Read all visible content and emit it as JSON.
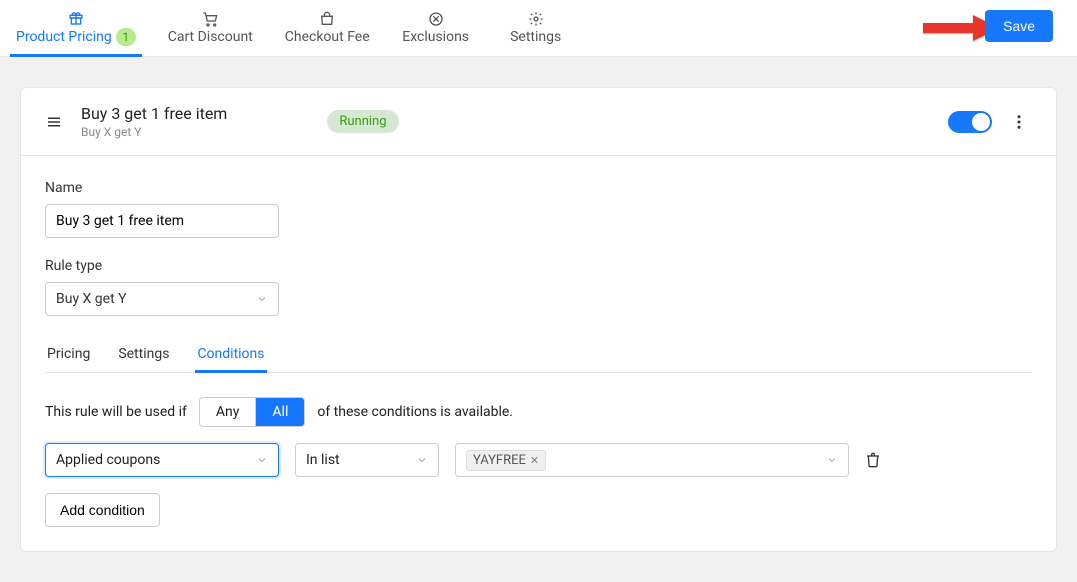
{
  "nav": {
    "tabs": [
      {
        "label": "Product Pricing",
        "badge": "1",
        "active": true
      },
      {
        "label": "Cart Discount",
        "active": false
      },
      {
        "label": "Checkout Fee",
        "active": false
      },
      {
        "label": "Exclusions",
        "active": false
      },
      {
        "label": "Settings",
        "active": false
      }
    ],
    "save_label": "Save"
  },
  "rule": {
    "title": "Buy 3 get 1 free item",
    "subtitle": "Buy X get Y",
    "status": "Running"
  },
  "form": {
    "name_label": "Name",
    "name_value": "Buy 3 get 1 free item",
    "ruletype_label": "Rule type",
    "ruletype_value": "Buy X get Y"
  },
  "subtabs": {
    "pricing": "Pricing",
    "settings": "Settings",
    "conditions": "Conditions"
  },
  "conditions": {
    "text_before": "This rule will be used if",
    "seg_any": "Any",
    "seg_all": "All",
    "text_after": "of these conditions is available.",
    "field_select": "Applied coupons",
    "operator_select": "In list",
    "tag_value": "YAYFREE",
    "add_label": "Add condition"
  }
}
